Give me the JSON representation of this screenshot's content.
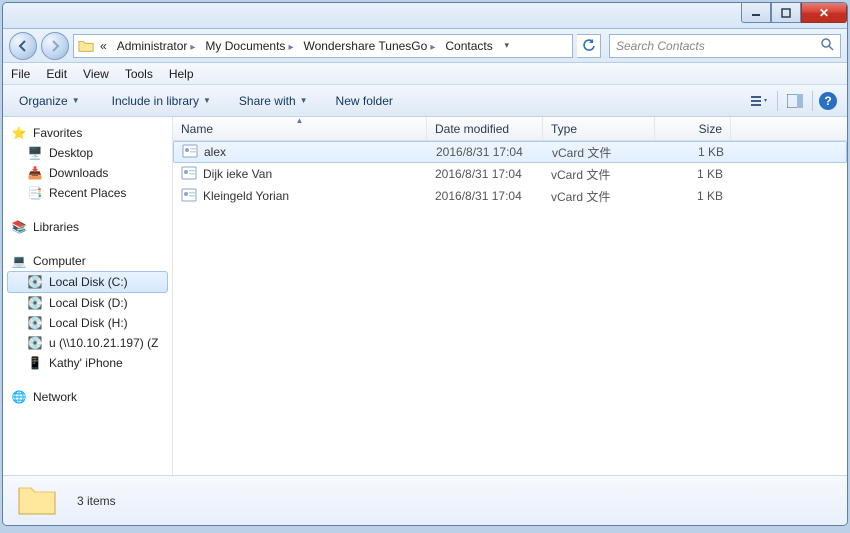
{
  "window_controls": {
    "min": "—",
    "max": "❐",
    "close": "✕"
  },
  "breadcrumbs": {
    "prefix": "«",
    "items": [
      "Administrator",
      "My Documents",
      "Wondershare TunesGo",
      "Contacts"
    ]
  },
  "search": {
    "placeholder": "Search Contacts"
  },
  "menubar": [
    "File",
    "Edit",
    "View",
    "Tools",
    "Help"
  ],
  "toolbar": {
    "organize": "Organize",
    "include": "Include in library",
    "share": "Share with",
    "newfolder": "New folder"
  },
  "columns": {
    "name": "Name",
    "date": "Date modified",
    "type": "Type",
    "size": "Size"
  },
  "nav": {
    "favorites": {
      "label": "Favorites",
      "items": [
        "Desktop",
        "Downloads",
        "Recent Places"
      ]
    },
    "libraries": {
      "label": "Libraries"
    },
    "computer": {
      "label": "Computer",
      "items": [
        "Local Disk (C:)",
        "Local Disk (D:)",
        "Local Disk (H:)",
        "u (\\\\10.10.21.197) (Z",
        "Kathy' iPhone"
      ]
    },
    "network": {
      "label": "Network"
    }
  },
  "files": [
    {
      "name": "alex",
      "date": "2016/8/31 17:04",
      "type": "vCard 文件",
      "size": "1 KB",
      "selected": true
    },
    {
      "name": "Dijk ieke Van",
      "date": "2016/8/31 17:04",
      "type": "vCard 文件",
      "size": "1 KB",
      "selected": false
    },
    {
      "name": "Kleingeld Yorian",
      "date": "2016/8/31 17:04",
      "type": "vCard 文件",
      "size": "1 KB",
      "selected": false
    }
  ],
  "details": {
    "count": "3 items"
  }
}
